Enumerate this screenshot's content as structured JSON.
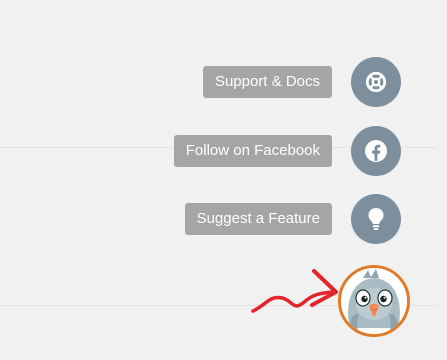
{
  "menu": {
    "items": [
      {
        "label": "Support & Docs",
        "icon": "lifebuoy-icon"
      },
      {
        "label": "Follow on Facebook",
        "icon": "facebook-icon"
      },
      {
        "label": "Suggest a Feature",
        "icon": "lightbulb-icon"
      }
    ]
  },
  "launcher": {
    "icon": "bird-mascot-icon",
    "border_color": "#e07b2a"
  },
  "colors": {
    "pill_bg": "#a3a5a6",
    "circle_bg": "#7d8e9d",
    "arrow": "#e3242b",
    "page_bg": "#f1f1f1"
  }
}
